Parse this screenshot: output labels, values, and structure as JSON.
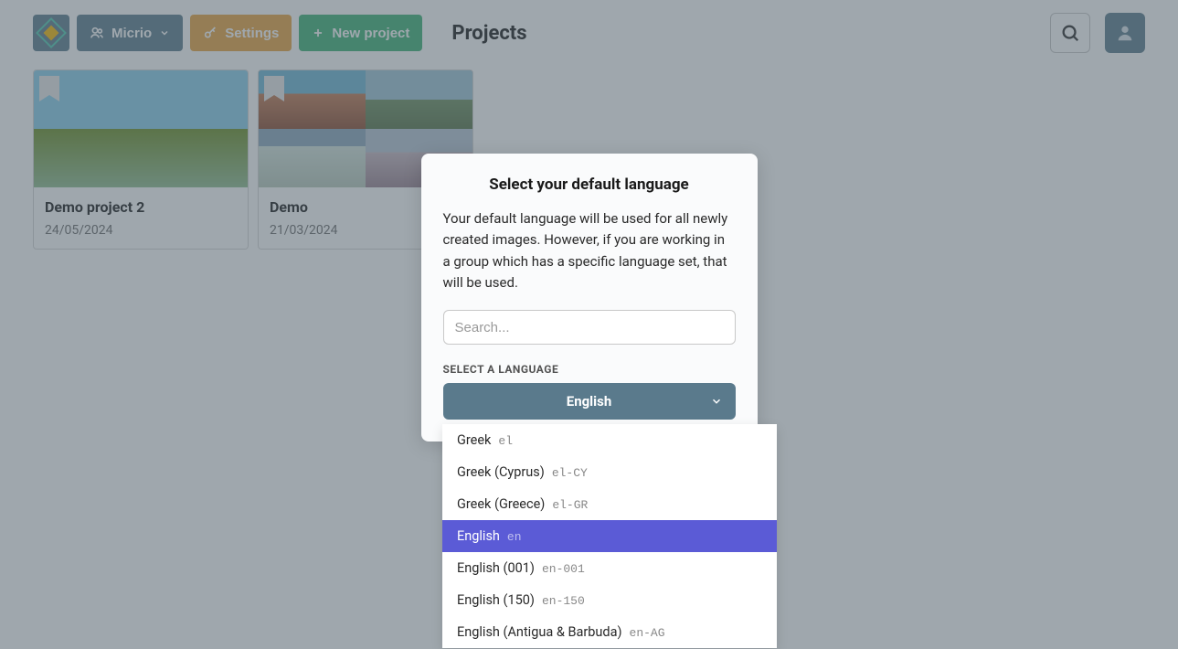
{
  "topbar": {
    "micrio_label": "Micrio",
    "settings_label": "Settings",
    "new_project_label": "New project",
    "page_title": "Projects"
  },
  "projects": [
    {
      "title": "Demo project 2",
      "date": "24/05/2024"
    },
    {
      "title": "Demo",
      "date": "21/03/2024"
    }
  ],
  "modal": {
    "title": "Select your default language",
    "description": "Your default language will be used for all newly created images. However, if you are working in a group which has a specific language set, that will be used.",
    "search_placeholder": "Search...",
    "select_label": "SELECT A LANGUAGE",
    "selected": "English"
  },
  "languages": [
    {
      "name": "Greek",
      "code": "el",
      "selected": false
    },
    {
      "name": "Greek (Cyprus)",
      "code": "el-CY",
      "selected": false
    },
    {
      "name": "Greek (Greece)",
      "code": "el-GR",
      "selected": false
    },
    {
      "name": "English",
      "code": "en",
      "selected": true
    },
    {
      "name": "English (001)",
      "code": "en-001",
      "selected": false
    },
    {
      "name": "English (150)",
      "code": "en-150",
      "selected": false
    },
    {
      "name": "English (Antigua & Barbuda)",
      "code": "en-AG",
      "selected": false
    }
  ]
}
